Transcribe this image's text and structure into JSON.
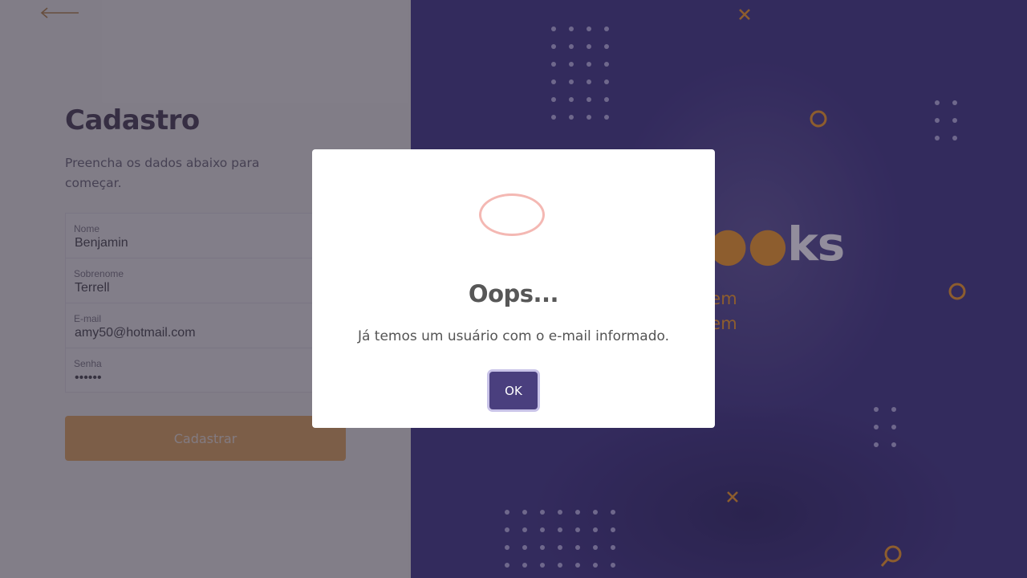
{
  "form": {
    "title": "Cadastro",
    "subtitle": "Preencha os dados abaixo para começar.",
    "fields": [
      {
        "label": "Nome",
        "value": "Benjamin"
      },
      {
        "label": "Sobrenome",
        "value": "Terrell"
      },
      {
        "label": "E-mail",
        "value": "amy50@hotmail.com"
      },
      {
        "label": "Senha",
        "value": "••••••"
      }
    ],
    "submit_label": "Cadastrar"
  },
  "brand": {
    "visible_suffix": "ks",
    "tagline_fragments": [
      "uem",
      "uem"
    ]
  },
  "modal": {
    "icon": "error-icon",
    "title": "Oops...",
    "message": "Já temos um usuário com o e-mail informado.",
    "ok_label": "OK"
  },
  "colors": {
    "accent": "#f0a64b",
    "brand_purple": "#3d3380",
    "title": "#2b1f3d",
    "button_ok": "#4a3f7e"
  }
}
